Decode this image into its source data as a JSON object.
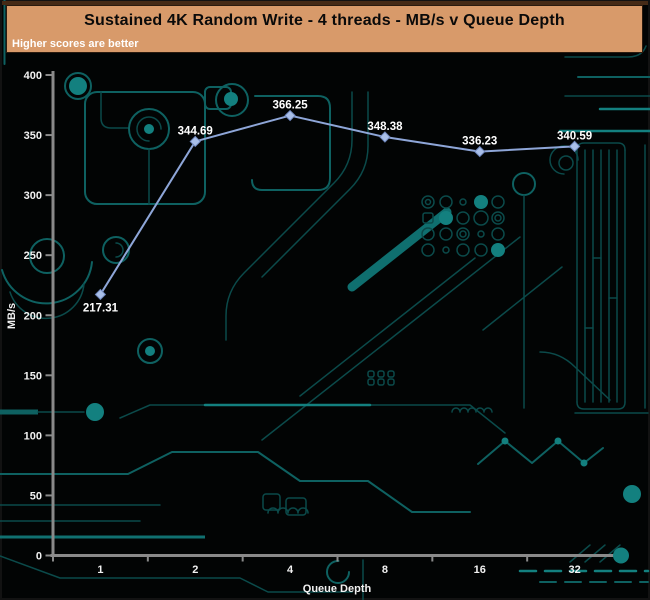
{
  "header": {
    "title": "Sustained 4K Random Write - 4 threads - MB/s v Queue Depth",
    "subtitle": "Higher scores are better"
  },
  "colors": {
    "banner_bg": "#d89a6a",
    "banner_text": "#0a0a0a",
    "subtitle_text": "#ffffff",
    "background": "#020404",
    "circuit_teal": "#0e6161",
    "circuit_bright_teal": "#13807f",
    "axis_gray": "#8a8a8a",
    "line": "#8ea6d8",
    "marker_fill": "#a9bfe9",
    "marker_stroke": "#6f87bd",
    "label_text": "#ffffff"
  },
  "chart_data": {
    "type": "line",
    "title": "Sustained 4K Random Write - 4 threads - MB/s v Queue Depth",
    "note": "Higher scores are better",
    "categories": [
      "1",
      "2",
      "4",
      "8",
      "16",
      "32"
    ],
    "series": [
      {
        "name": "MB/s",
        "values": [
          217.31,
          344.69,
          366.25,
          348.38,
          336.23,
          340.59
        ]
      }
    ],
    "point_labels": [
      "217.31",
      "344.69",
      "366.25",
      "348.38",
      "336.23",
      "340.59"
    ],
    "xlabel": "Queue Depth",
    "ylabel": "MB/s",
    "ylim": [
      0,
      400
    ],
    "yticks": [
      0,
      50,
      100,
      150,
      200,
      250,
      300,
      350,
      400
    ],
    "grid": false,
    "legend": null,
    "marker": "diamond"
  }
}
